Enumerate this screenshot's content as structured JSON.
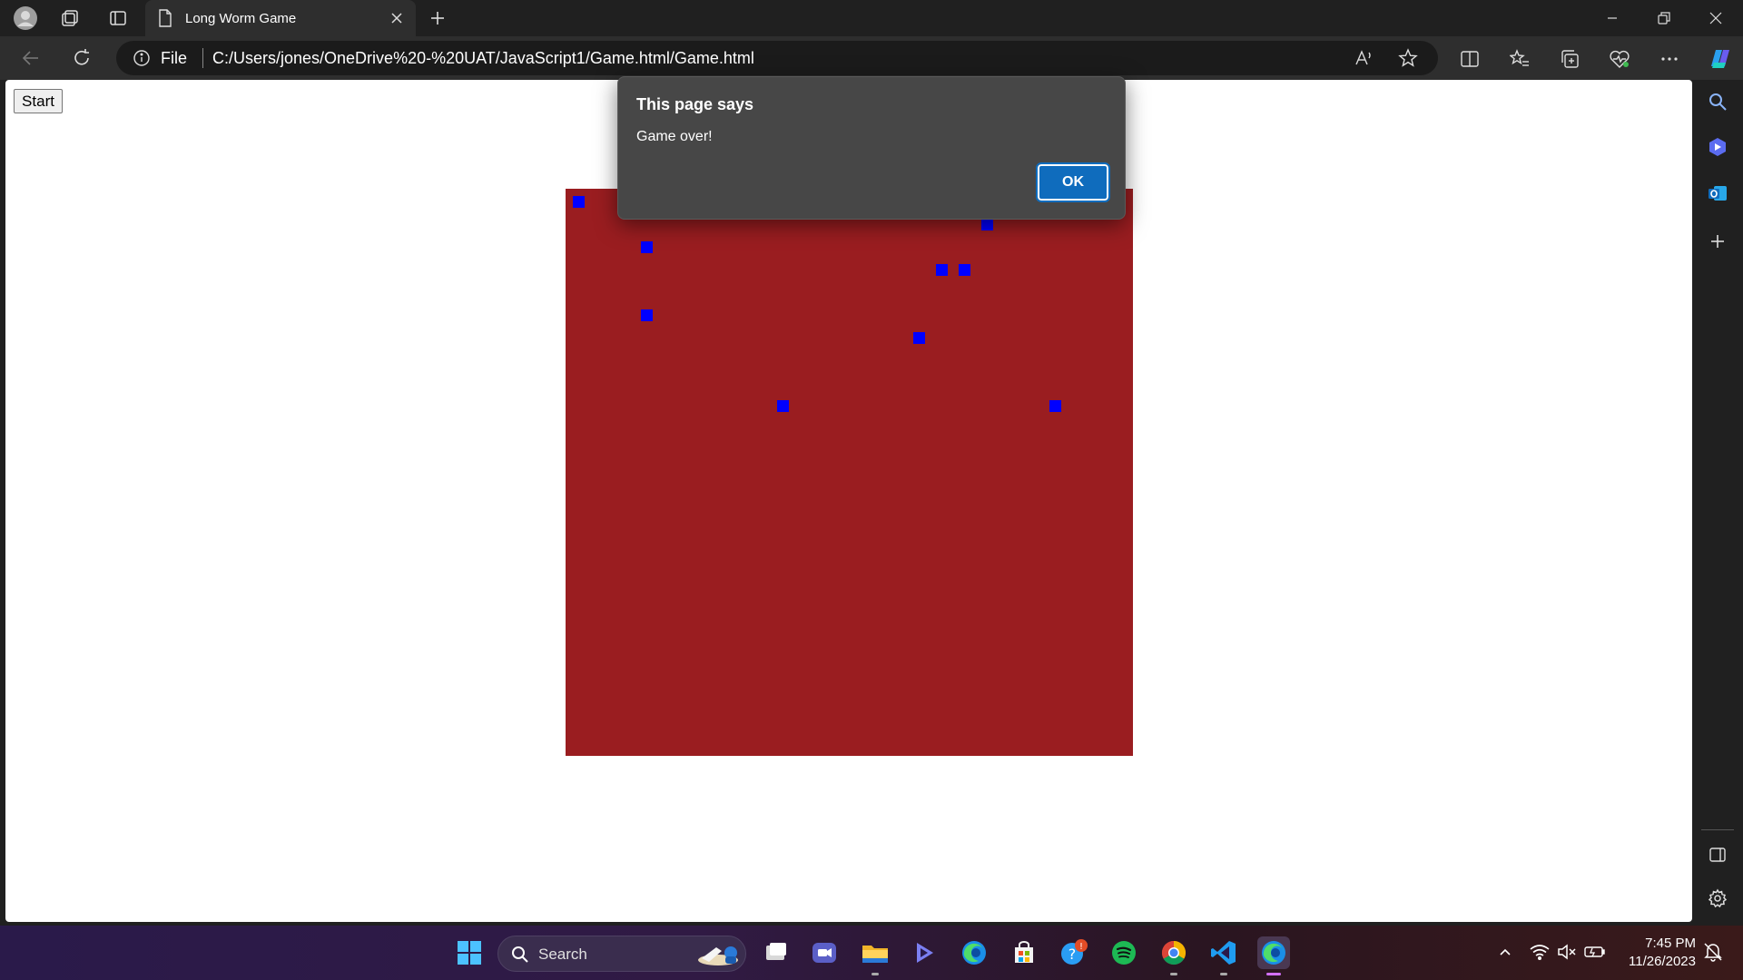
{
  "browser": {
    "tab_title": "Long Worm Game",
    "address": {
      "scheme_label": "File",
      "url": "C:/Users/jones/OneDrive%20-%20UAT/JavaScript1/Game.html/Game.html"
    }
  },
  "page": {
    "start_button_label": "Start",
    "game": {
      "background_color": "#9a1d20",
      "cell_color": "#0000ff",
      "grid_cells": [
        {
          "col": 0,
          "row": 0
        },
        {
          "col": 3,
          "row": 2
        },
        {
          "col": 3,
          "row": 5
        },
        {
          "col": 9,
          "row": 9
        },
        {
          "col": 15,
          "row": 6
        },
        {
          "col": 16,
          "row": 3
        },
        {
          "col": 17,
          "row": 3
        },
        {
          "col": 18,
          "row": 1
        },
        {
          "col": 21,
          "row": 9
        }
      ]
    }
  },
  "dialog": {
    "title": "This page says",
    "message": "Game over!",
    "ok_label": "OK"
  },
  "taskbar": {
    "search_label": "Search",
    "time": "7:45 PM",
    "date": "11/26/2023"
  },
  "colors": {
    "accent": "#0f6cbd",
    "chrome_bg": "#202020"
  }
}
